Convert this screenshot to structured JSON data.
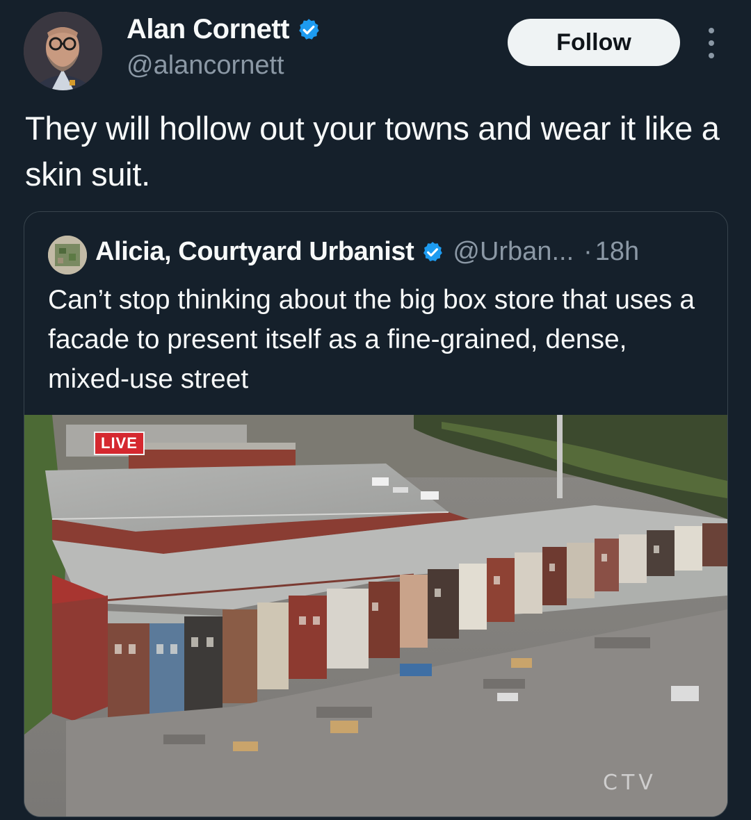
{
  "author": {
    "name": "Alan Cornett",
    "handle": "@alancornett",
    "verified": true
  },
  "actions": {
    "follow_label": "Follow",
    "more_icon": "more-vertical-icon"
  },
  "tweet": {
    "text": "They will hollow out your towns and wear it like a skin suit."
  },
  "quote": {
    "name": "Alicia, Courtyard Urbanist",
    "handle": "@Urban...",
    "separator": "·",
    "time": "18h",
    "verified": true,
    "text": "Can’t stop thinking about the big box store that uses a facade to present itself as a fine-grained, dense, mixed-use street"
  },
  "media": {
    "live_badge": "LIVE",
    "watermark": "CTV"
  },
  "colors": {
    "background": "#15202b",
    "verified_blue": "#1d9bf0",
    "secondary_text": "#8b98a5",
    "follow_button": "#eff3f4"
  }
}
